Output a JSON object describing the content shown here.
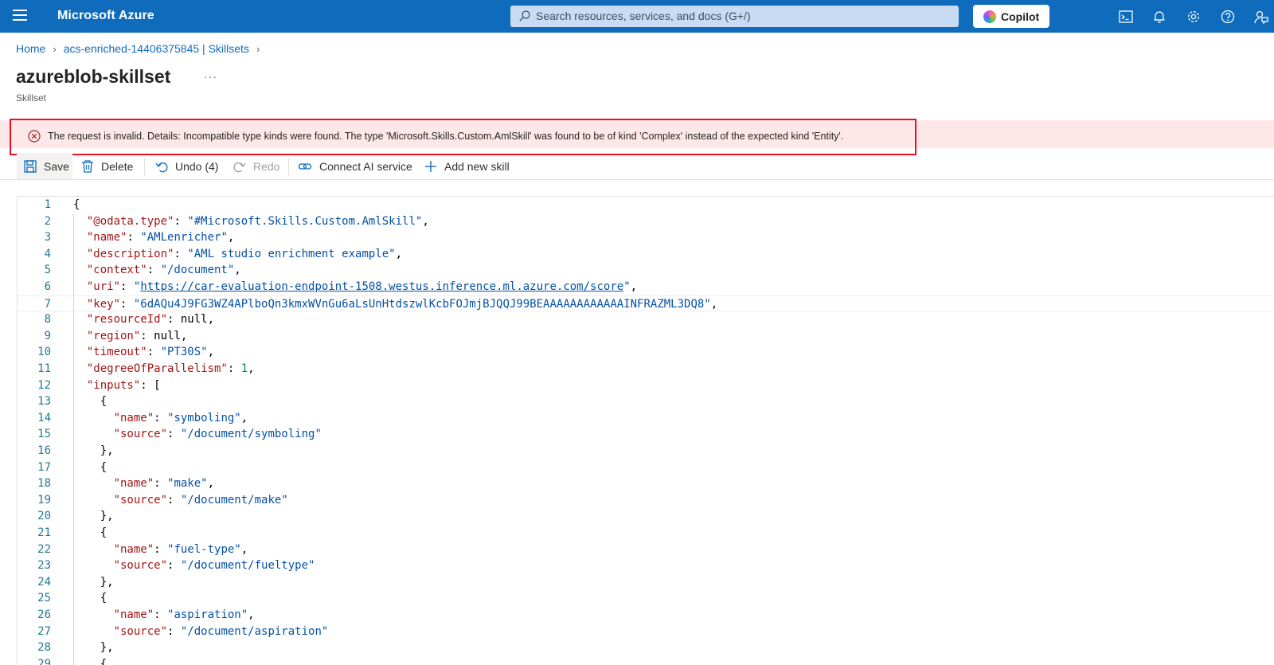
{
  "topbar": {
    "brand": "Microsoft Azure",
    "search_placeholder": "Search resources, services, and docs (G+/)",
    "copilot_label": "Copilot",
    "icons": [
      "cloud-shell-icon",
      "notifications-icon",
      "settings-icon",
      "help-icon",
      "feedback-icon"
    ]
  },
  "breadcrumb": {
    "items": [
      "Home",
      "acs-enriched-14406375845 | Skillsets"
    ]
  },
  "page": {
    "title": "azureblob-skillset",
    "more": "···",
    "subtitle": "Skillset"
  },
  "error": {
    "message": "The request is invalid. Details: Incompatible type kinds were found. The type 'Microsoft.Skills.Custom.AmlSkill' was found to be of kind 'Complex' instead of the expected kind 'Entity'.",
    "color": "#e81123"
  },
  "toolbar": {
    "save": "Save",
    "delete": "Delete",
    "undo": "Undo (4)",
    "redo": "Redo",
    "connect_ai": "Connect AI service",
    "add_skill": "Add new skill"
  },
  "editor": {
    "current_line": 7,
    "lines": [
      "{",
      "  \"@odata.type\": \"#Microsoft.Skills.Custom.AmlSkill\",",
      "  \"name\": \"AMLenricher\",",
      "  \"description\": \"AML studio enrichment example\",",
      "  \"context\": \"/document\",",
      "  \"uri\": \"https://car-evaluation-endpoint-1508.westus.inference.ml.azure.com/score\",",
      "  \"key\": \"6dAQu4J9FG3WZ4APlboQn3kmxWVnGu6aLsUnHtdszwlKcbFOJmjBJQQJ99BEAAAAAAAAAAAAINFRAZML3DQ8\",",
      "  \"resourceId\": null,",
      "  \"region\": null,",
      "  \"timeout\": \"PT30S\",",
      "  \"degreeOfParallelism\": 1,",
      "  \"inputs\": [",
      "    {",
      "      \"name\": \"symboling\",",
      "      \"source\": \"/document/symboling\"",
      "    },",
      "    {",
      "      \"name\": \"make\",",
      "      \"source\": \"/document/make\"",
      "    },",
      "    {",
      "      \"name\": \"fuel-type\",",
      "      \"source\": \"/document/fueltype\"",
      "    },",
      "    {",
      "      \"name\": \"aspiration\",",
      "      \"source\": \"/document/aspiration\"",
      "    },",
      "    {"
    ]
  }
}
